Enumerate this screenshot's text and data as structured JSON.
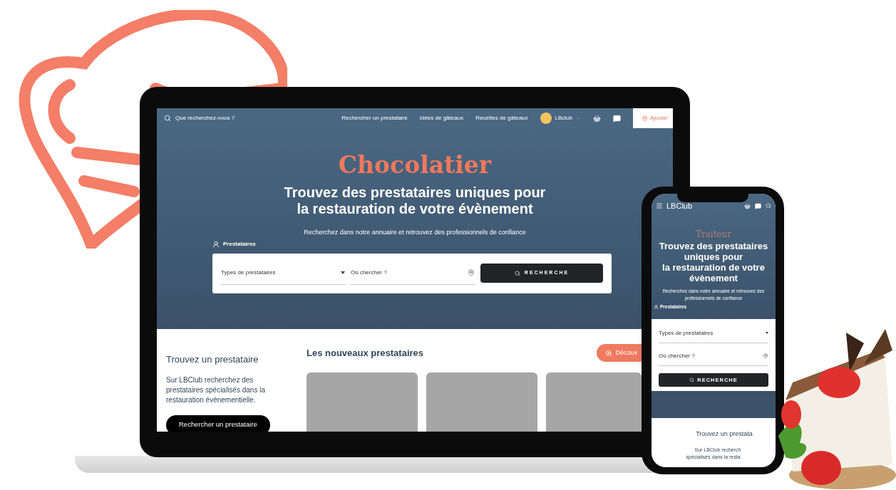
{
  "laptop": {
    "header": {
      "search_placeholder": "Que recherchez-vous ?",
      "nav": [
        "Rechercher un prestataire",
        "Idées de gâteaux",
        "Recettes de gâteaux"
      ],
      "account": "LBclub",
      "add_button": "Ajouter"
    },
    "hero": {
      "category": "Chocolatier",
      "headline": [
        "Trouvez des prestataires uniques pour",
        "la restauration de votre évènement"
      ],
      "subtitle": "Recherchez dans notre annuaire et retrouvez des professionnels de confiance",
      "tab_label": "Prestataires",
      "type_select": "Types de prestataires",
      "location_placeholder": "Où chercher ?",
      "search_button": "RECHERCHE"
    },
    "finder": {
      "title": "Trouvez un prestataire",
      "text": "Sur LBClub recherchez des prestataires spécialisés dans la restauration évènementielle.",
      "button": "Rechercher un prestataire"
    },
    "new_providers": {
      "title": "Les nouveaux prestataires",
      "button": "Découv",
      "cards": [
        {
          "kind": "empty"
        },
        {
          "kind": "empty"
        },
        {
          "kind": "empty"
        }
      ]
    }
  },
  "phone": {
    "brand": "LBClub",
    "category": "Traiteur",
    "headline": [
      "Trouvez des prestataires uniques pour",
      "la restauration de votre évènement"
    ],
    "subtitle": "Recherchez dans notre annuaire et retrouvez des professionnels de confiance",
    "tab_label": "Prestataires",
    "type_select": "Types de prestataires",
    "location_placeholder": "Où chercher ?",
    "search_button": "RECHERCHE",
    "finder_title": "Trouvez un prestata",
    "finder_text": [
      "Sur LBClub recherch",
      "spécialisés dans la resta"
    ]
  }
}
